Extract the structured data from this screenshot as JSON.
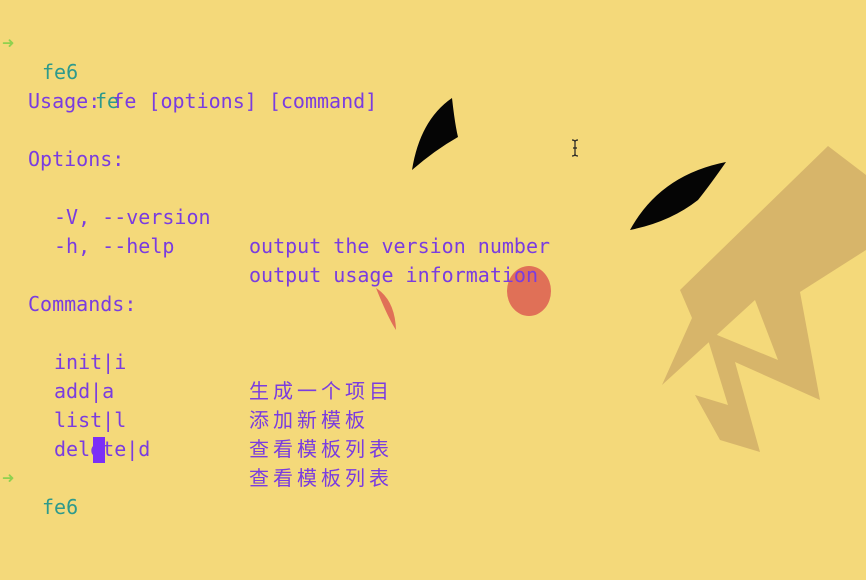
{
  "terminal": {
    "prompt_arrow": "➜",
    "prompt_dir": "fe6",
    "first_command": "fe",
    "usage_line": "Usage: fe [options] [command]",
    "options_header": "Options:",
    "options": [
      {
        "flag": "-V, --version",
        "description": "output the version number"
      },
      {
        "flag": "-h, --help",
        "description": "output usage information"
      }
    ],
    "commands_header": "Commands:",
    "commands": [
      {
        "name": "init|i",
        "description": "生成一个项目"
      },
      {
        "name": "add|a",
        "description": "添加新模板"
      },
      {
        "name": "list|l",
        "description": "查看模板列表"
      },
      {
        "name": "delete|d",
        "description": "查看模板列表"
      }
    ]
  },
  "colors": {
    "background": "#f4d97a",
    "text": "#7a3ce0",
    "prompt_arrow": "#8fd14f",
    "prompt_dir": "#2e9a8c",
    "cursor": "#7b2ff7"
  },
  "icons": {
    "pointer": "text-cursor-ibeam-icon"
  }
}
